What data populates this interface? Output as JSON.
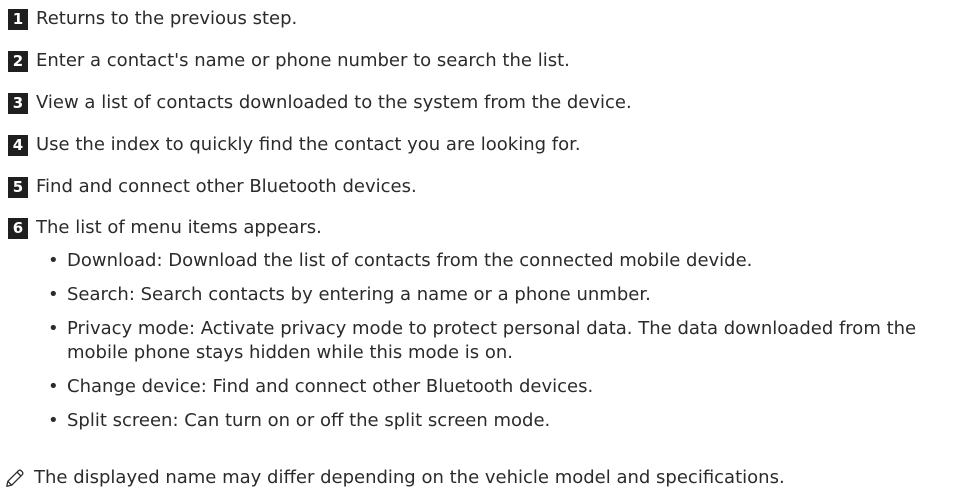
{
  "steps": [
    {
      "number": "1",
      "text": "Returns to the previous step."
    },
    {
      "number": "2",
      "text": "Enter a contact's name or phone number to search the list."
    },
    {
      "number": "3",
      "text": "View a list of contacts downloaded to the system from the device."
    },
    {
      "number": "4",
      "text": "Use the index to quickly find the contact you are looking for."
    },
    {
      "number": "5",
      "text": "Find and connect other Bluetooth devices."
    },
    {
      "number": "6",
      "text": "The list of menu items appears."
    }
  ],
  "menu_items": [
    "Download: Download the list of contacts from the connected mobile devide.",
    "Search: Search contacts by entering a name or a phone unmber.",
    "Privacy mode: Activate privacy mode to protect personal data. The data downloaded from the mobile phone stays hidden while this mode is on.",
    "Change device: Find and connect other Bluetooth devices.",
    "Split screen: Can turn on or off the split screen mode."
  ],
  "bullet_glyph": "•",
  "note": {
    "icon": "pencil-icon",
    "text": "The displayed name may differ depending on the vehicle model and specifications."
  },
  "colors": {
    "text": "#2b2b2b",
    "badge_background": "#1f1f1f",
    "badge_text": "#ffffff"
  }
}
